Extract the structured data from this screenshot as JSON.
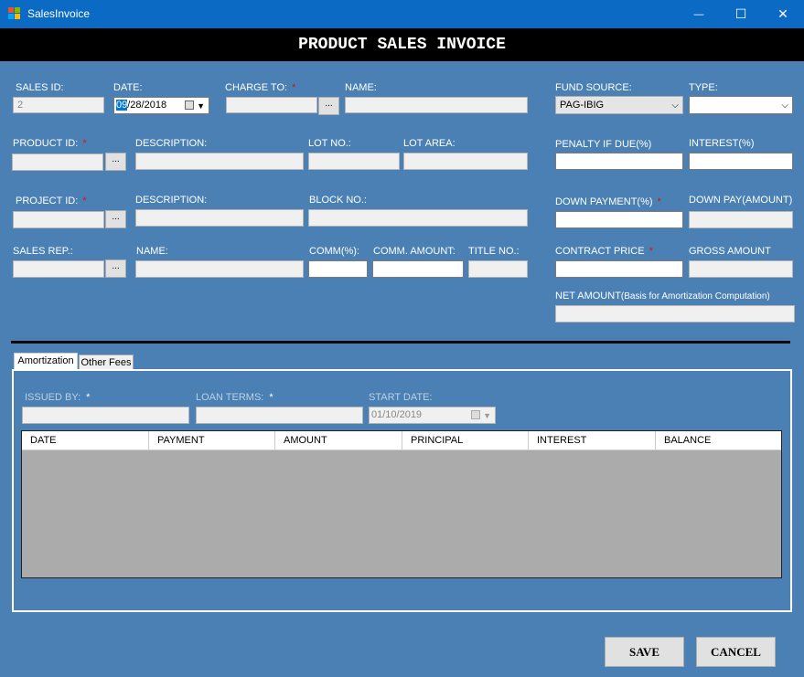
{
  "window": {
    "title": "SalesInvoice",
    "minimize_glyph": "—",
    "maximize_glyph": "☐",
    "close_glyph": "✕"
  },
  "banner": "PRODUCT SALES INVOICE",
  "labels": {
    "sales_id": "SALES ID:",
    "date": "DATE:",
    "charge_to": "CHARGE TO:",
    "name": "NAME:",
    "fund_source": "FUND SOURCE:",
    "type": "TYPE:",
    "product_id": "PRODUCT ID:",
    "description": "DESCRIPTION:",
    "lot_no": "LOT NO.:",
    "lot_area": "LOT AREA:",
    "penalty": "PENALTY IF DUE(%)",
    "interest": "INTEREST(%)",
    "project_id": "PROJECT ID:",
    "block_no": "BLOCK NO.:",
    "down_payment_pct": "DOWN PAYMENT(%)",
    "down_pay_amount": "DOWN PAY(AMOUNT)",
    "sales_rep": "SALES REP.:",
    "comm_pct": "COMM(%):",
    "comm_amount": "COMM. AMOUNT:",
    "title_no": "TITLE NO.:",
    "contract_price": "CONTRACT PRICE",
    "gross_amount": "GROSS AMOUNT",
    "net_amount": "NET AMOUNT",
    "net_amount_note": "(Basis for Amortization Computation)",
    "required_mark": "*"
  },
  "values": {
    "sales_id": "2",
    "date_month": "09",
    "date_rest": "/28/2018",
    "fund_source": "PAG-IBIG",
    "type": "",
    "browse_glyph": "..."
  },
  "tabs": {
    "amortization": "Amortization",
    "other_fees": "Other Fees"
  },
  "amortization": {
    "issued_by": "ISSUED BY:",
    "loan_terms": "LOAN TERMS:",
    "start_date": "START DATE:",
    "start_date_value": "01/10/2019",
    "columns": [
      "DATE",
      "PAYMENT",
      "AMOUNT",
      "PRINCIPAL",
      "INTEREST",
      "BALANCE"
    ]
  },
  "buttons": {
    "save": "SAVE",
    "cancel": "CANCEL"
  },
  "colors": {
    "title_bar": "#0b6bc4",
    "form_bg": "#4a80b4",
    "banner_bg": "#000000",
    "required": "#e01010",
    "grid_bg": "#ababab"
  },
  "icons": {
    "dropdown": "chevron-down-icon",
    "calendar": "calendar-icon",
    "app": "app-icon"
  }
}
